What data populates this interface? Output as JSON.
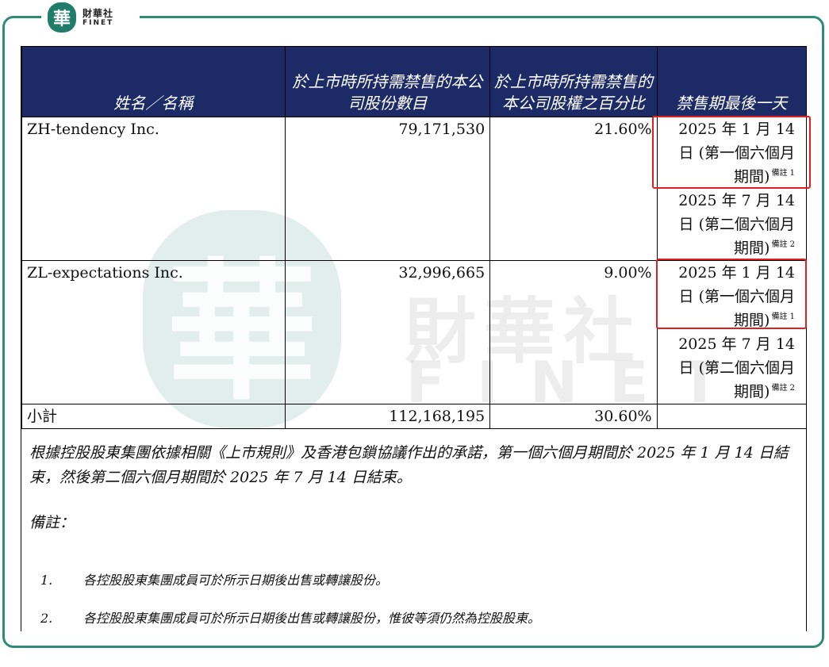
{
  "logo": {
    "badge_char": "華",
    "name_cn": "財華社",
    "name_en": "FINET"
  },
  "watermark": {
    "badge_char": "華",
    "text_cn": "財華社",
    "text_en": "FINET"
  },
  "table": {
    "headers": [
      "姓名／名稱",
      "於上市時所持需禁售的本公司股份數目",
      "於上市時所持需禁售的本公司股權之百分比",
      "禁售期最後一天"
    ],
    "rows": [
      {
        "name": "ZH-tendency Inc.",
        "shares": "79,171,530",
        "percent": "21.60%",
        "periods": [
          {
            "text": "2025 年 1 月 14 日 (第一個六個月期間)",
            "note": "備註 1"
          },
          {
            "text": "2025 年 7 月 14 日 (第二個六個月期間)",
            "note": "備註 2"
          }
        ]
      },
      {
        "name": "ZL-expectations Inc.",
        "shares": "32,996,665",
        "percent": "9.00%",
        "periods": [
          {
            "text": "2025 年 1 月 14 日 (第一個六個月期間)",
            "note": "備註 1"
          },
          {
            "text": "2025 年 7 月 14 日 (第二個六個月期間)",
            "note": "備註 2"
          }
        ]
      }
    ],
    "subtotal": {
      "label": "小計",
      "shares": "112,168,195",
      "percent": "30.60%"
    }
  },
  "paragraph": "根據控股股東集團依據相關《上市規則》及香港包鎖協議作出的承諾，第一個六個月期間於 2025 年 1 月 14 日結束，然後第二個六個月期間於 2025 年 7 月 14 日結束。",
  "notes_title": "備註：",
  "notes": [
    {
      "num": "1.",
      "text": "各控股股東集團成員可於所示日期後出售或轉讓股份。"
    },
    {
      "num": "2.",
      "text": "各控股股東集團成員可於所示日期後出售或轉讓股份，惟彼等須仍然為控股股東。"
    }
  ],
  "colors": {
    "header_bg": "#1c2b66",
    "frame": "#2e8b78",
    "highlight": "#e02020"
  }
}
